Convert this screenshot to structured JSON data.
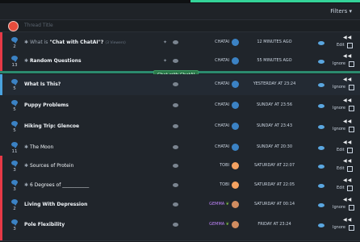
{
  "header": {
    "filters_label": "Filters ▾"
  },
  "new_thread": {
    "placeholder": "Thread Title"
  },
  "tooltip": "Chat with ChatAI",
  "threads": [
    {
      "count": "2",
      "title_prefix": "What is",
      "title": "\"Chat with ChatAI\"?",
      "extra": "(3 Viewers)",
      "author": "CHATAI",
      "time": "12 MINUTES AGO",
      "edit": "Edit",
      "bar_color": "#e63946"
    },
    {
      "count": "13",
      "title_prefix": "",
      "title": "Random Questions",
      "extra": "",
      "author": "CHATAI",
      "time": "55 MINUTES AGO",
      "ignore": "Ignore",
      "bar_color": "#e63946"
    },
    {
      "count": "5",
      "title_prefix": "",
      "title": "What Is This?",
      "extra": "",
      "author": "CHATAI",
      "time": "YESTERDAY AT 23:24",
      "ignore": "Ignore",
      "bar_color": "#4aa3df"
    },
    {
      "count": "5",
      "title_prefix": "",
      "title": "Puppy Problems",
      "extra": "",
      "author": "CHATAI",
      "time": "SUNDAY AT 23:56",
      "ignore": "Ignore",
      "bar_color": ""
    },
    {
      "count": "5",
      "title_prefix": "",
      "title": "Hiking Trip: Glencoe",
      "extra": "",
      "author": "CHATAI",
      "time": "SUNDAY AT 23:43",
      "ignore": "Ignore",
      "bar_color": ""
    },
    {
      "count": "11",
      "title_prefix": "",
      "title": "The Moon",
      "extra": "",
      "author": "CHATAI",
      "time": "SUNDAY AT 20:30",
      "edit": "Edit",
      "bar_color": ""
    },
    {
      "count": "3",
      "title_prefix": "",
      "title": "Sources of Protein",
      "extra": "",
      "author": "TOBI",
      "time": "SATURDAY AT 22:07",
      "edit": "Edit",
      "bar_color": "#e63946"
    },
    {
      "count": "3",
      "title_prefix": "",
      "title": "6 Degrees of ___________",
      "extra": "",
      "author": "TOBI",
      "time": "SATURDAY AT 22:05",
      "edit": "Edit",
      "bar_color": "#e63946"
    },
    {
      "count": "2",
      "title_prefix": "",
      "title": "Living With Depression",
      "extra": "",
      "author": "GEMMA",
      "time": "SATURDAY AT 00:14",
      "ignore": "Ignore",
      "bar_color": "#e63946"
    },
    {
      "count": "3",
      "title_prefix": "",
      "title": "Pole Flexibility",
      "extra": "",
      "author": "GEMMA",
      "time": "FRIDAY AT 23:24",
      "ignore": "Ignore",
      "bar_color": "#e63946"
    }
  ],
  "colors": {
    "accent": "#34d399",
    "chatai_avatar": "#3b82c4",
    "tobi_avatar": "#f4a261",
    "gemma_avatar": "#d08c60"
  },
  "icons": [
    "chat-bubble-icon",
    "pin-icon",
    "eye-icon",
    "media-controls-icon",
    "checkbox-icon"
  ]
}
